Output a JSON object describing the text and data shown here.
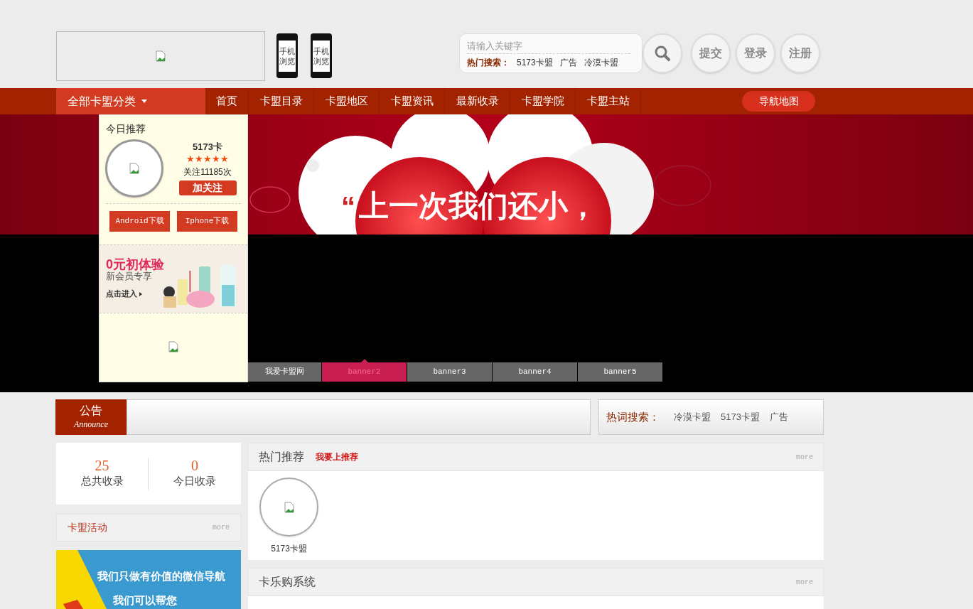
{
  "header": {
    "phone_links": [
      "手机浏览",
      "手机浏览"
    ],
    "search": {
      "placeholder": "请输入关键字",
      "hot_label": "热门搜索：",
      "hot_words": [
        "5173卡盟",
        "广告",
        "冷漠卡盟"
      ]
    },
    "round_buttons": [
      "提交",
      "登录",
      "注册"
    ]
  },
  "nav": {
    "category_menu": "全部卡盟分类",
    "items": [
      "首页",
      "卡盟目录",
      "卡盟地区",
      "卡盟资讯",
      "最新收录",
      "卡盟学院",
      "卡盟主站"
    ],
    "map_button": "导航地图"
  },
  "recommend_panel": {
    "title": "今日推荐",
    "name": "5173卡",
    "stars": 5,
    "follows": "关注11185次",
    "follow_button": "加关注",
    "downloads": [
      "Android下载",
      "Iphone下载"
    ],
    "ad": {
      "headline": "0元初体验",
      "subline": "新会员专享",
      "link": "点击进入"
    }
  },
  "banner": {
    "quote_mark": "“",
    "headline": "上一次我们还小，",
    "tabs": [
      {
        "label": "我爱卡盟网",
        "selected": false
      },
      {
        "label": "banner2",
        "selected": true
      },
      {
        "label": "banner3",
        "selected": false
      },
      {
        "label": "banner4",
        "selected": false
      },
      {
        "label": "banner5",
        "selected": false
      }
    ]
  },
  "announce": {
    "title": "公告",
    "subtitle": "Announce"
  },
  "hot_terms": {
    "label": "热词搜索：",
    "words": [
      "冷漠卡盟",
      "5173卡盟",
      "广告"
    ]
  },
  "stats": [
    {
      "value": "25",
      "label": "总共收录"
    },
    {
      "value": "0",
      "label": "今日收录"
    }
  ],
  "activity": {
    "title": "卡盟活动",
    "more": "more"
  },
  "side_ad": {
    "lines": [
      "我们只做有价值的微信导航",
      "我们可以帮您"
    ]
  },
  "sections": [
    {
      "title": "热门推荐",
      "link": "我要上推荐",
      "more": "more",
      "items": [
        {
          "name": "5173卡盟"
        }
      ]
    },
    {
      "title": "卡乐购系统",
      "more": "more"
    }
  ]
}
